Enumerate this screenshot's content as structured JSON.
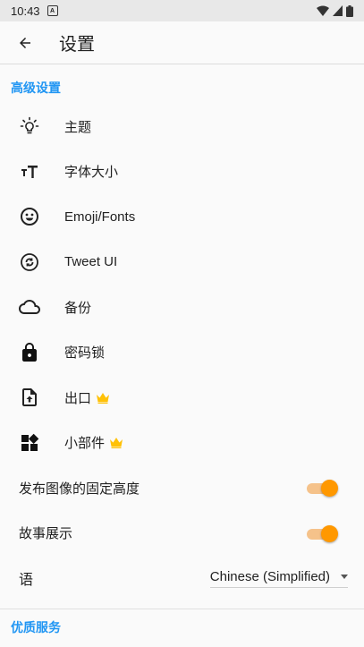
{
  "status_bar": {
    "time": "10:43",
    "notification_glyph": "A",
    "icons": [
      "wifi-icon",
      "signal-icon",
      "battery-icon"
    ]
  },
  "app_bar": {
    "title": "设置",
    "back_icon": "arrow-back-icon"
  },
  "sections": {
    "advanced": {
      "header": "高级设置",
      "items": [
        {
          "label": "主题",
          "icon": "lightbulb-icon",
          "premium": false
        },
        {
          "label": "字体大小",
          "icon": "text-size-icon",
          "premium": false
        },
        {
          "label": "Emoji/Fonts",
          "icon": "smiley-icon",
          "premium": false
        },
        {
          "label": "Tweet UI",
          "icon": "sync-icon",
          "premium": false
        },
        {
          "label": "备份",
          "icon": "cloud-icon",
          "premium": false
        },
        {
          "label": "密码锁",
          "icon": "lock-icon",
          "premium": false
        },
        {
          "label": "出口",
          "icon": "file-upload-icon",
          "premium": true
        },
        {
          "label": "小部件",
          "icon": "widgets-icon",
          "premium": true
        }
      ]
    },
    "toggles": [
      {
        "label": "发布图像的固定高度",
        "checked": true
      },
      {
        "label": "故事展示",
        "checked": true
      }
    ],
    "language": {
      "label": "语",
      "value": "Chinese (Simplified)"
    },
    "premium": {
      "header": "优质服务"
    }
  },
  "colors": {
    "accent": "#2196f3",
    "switch_on": "#ff9800",
    "crown": "#ffc107"
  }
}
